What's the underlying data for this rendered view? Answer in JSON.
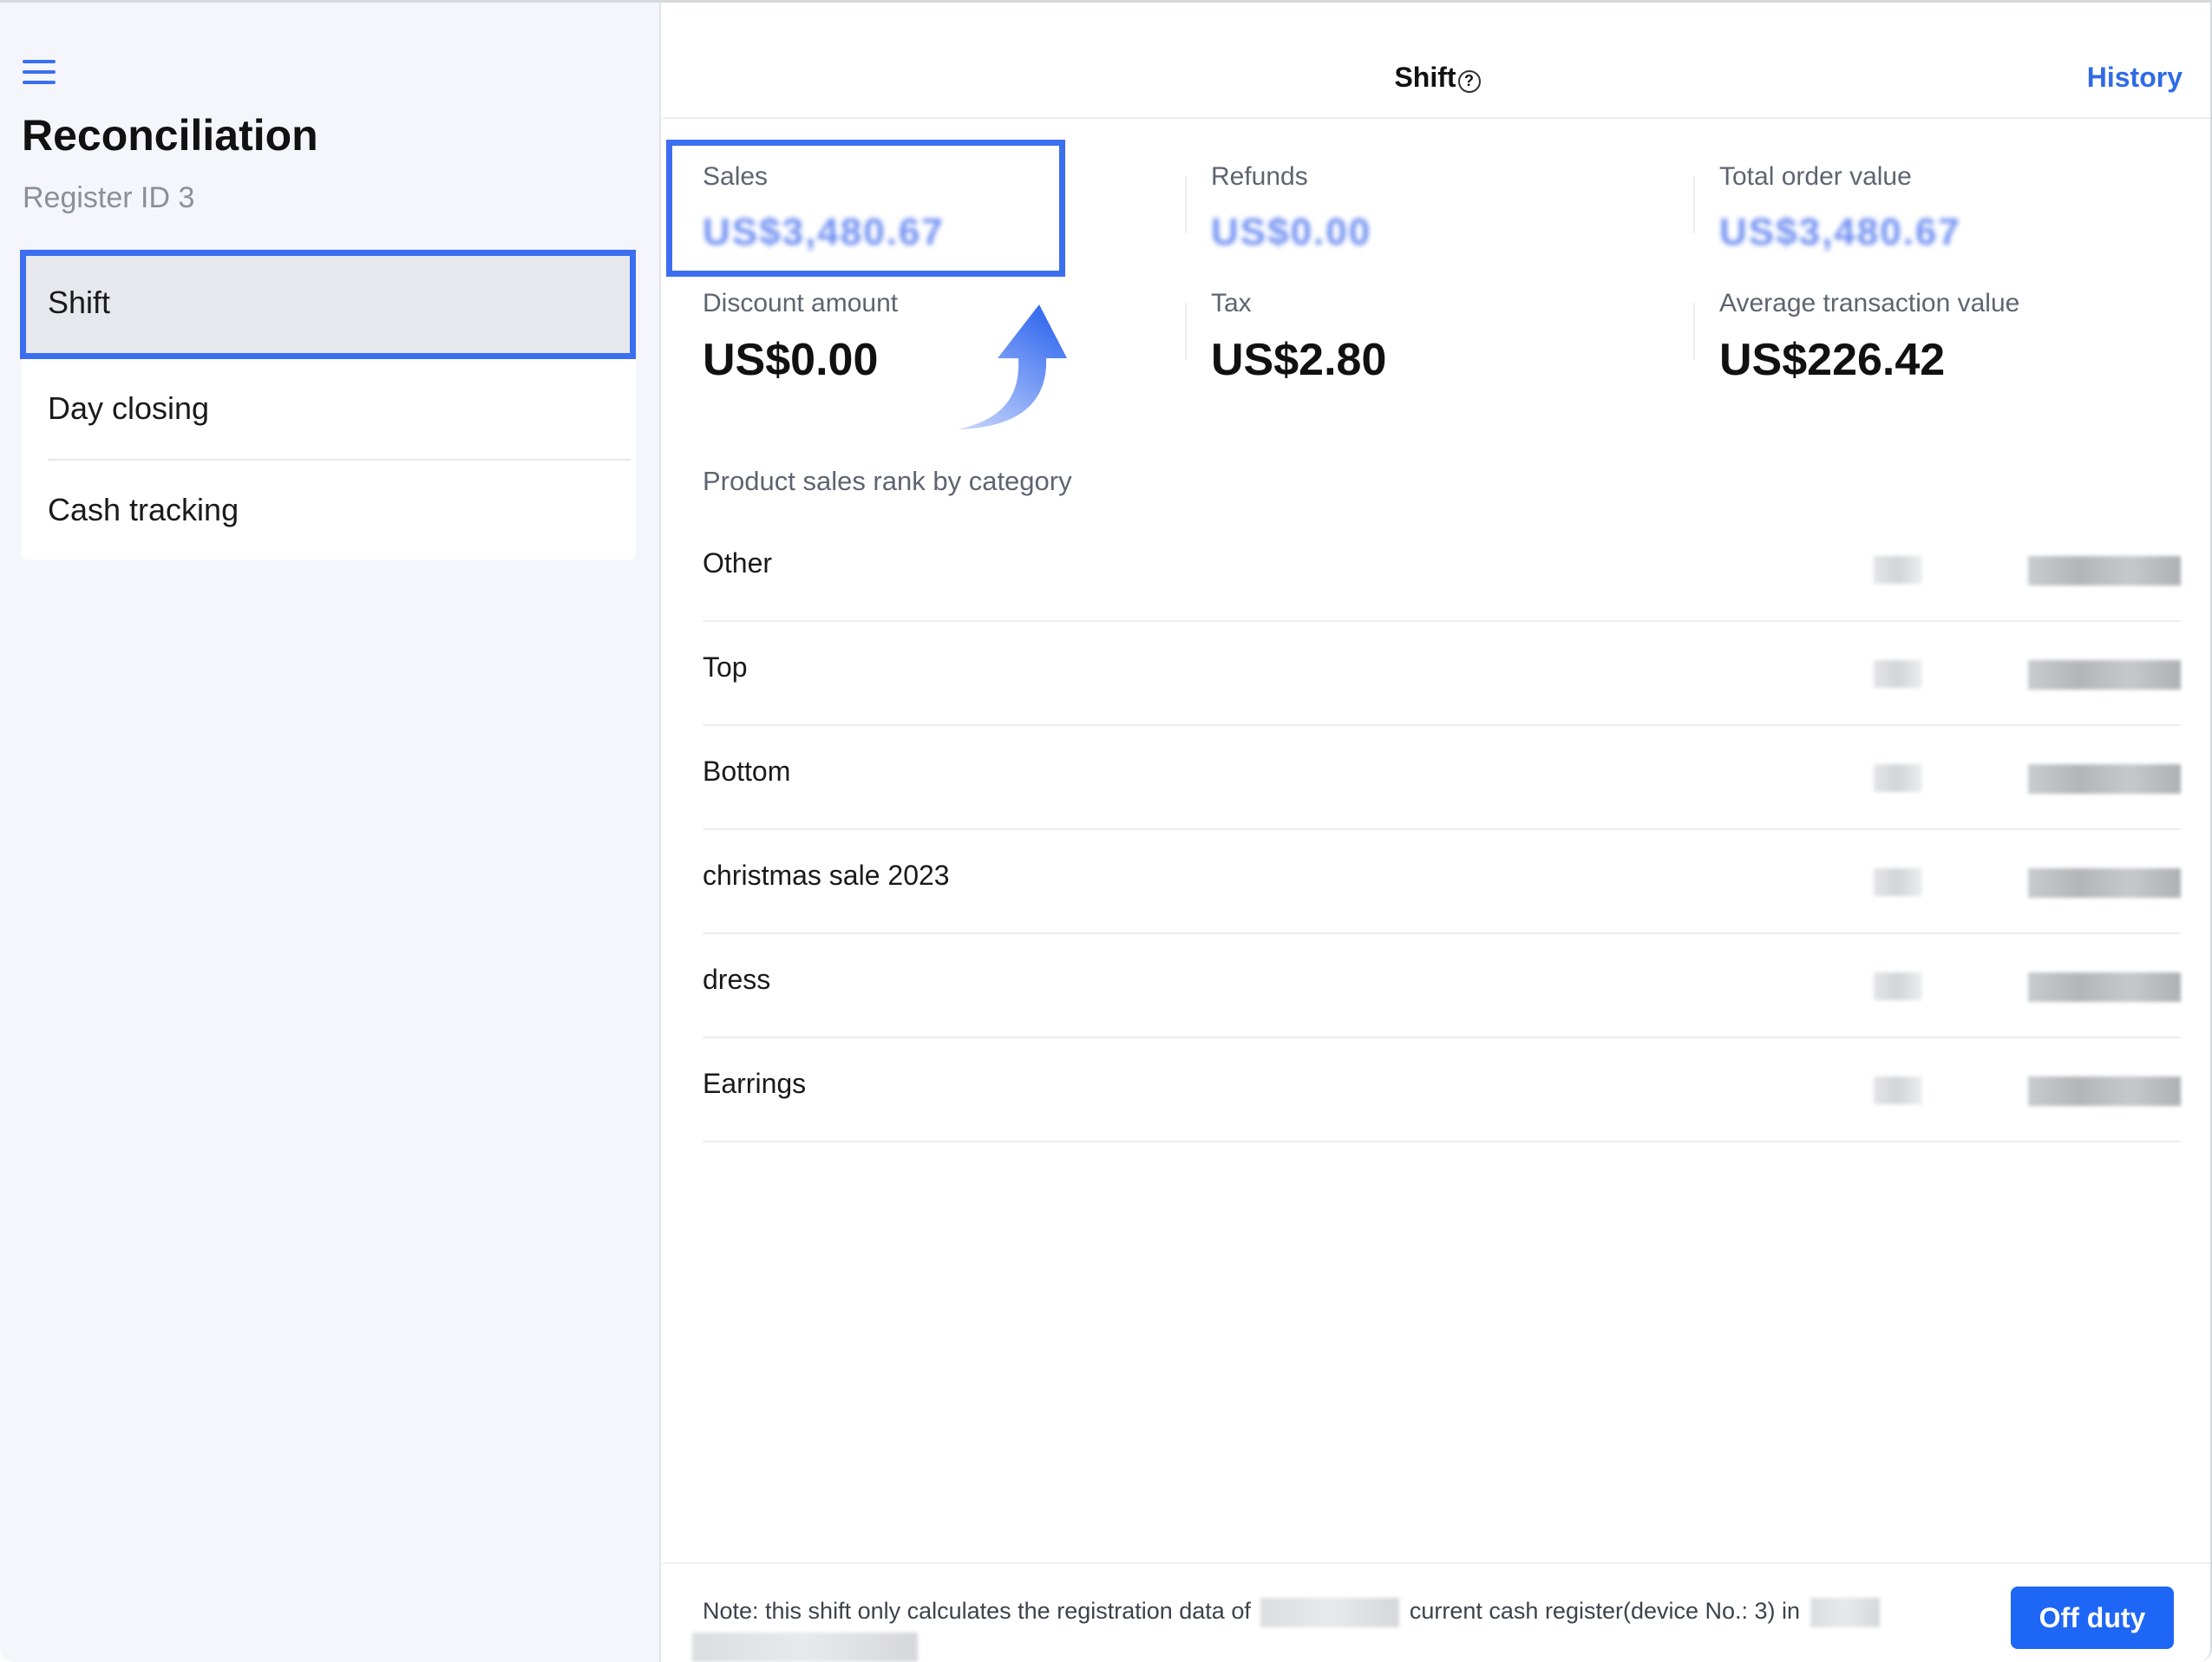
{
  "sidebar": {
    "title": "Reconciliation",
    "subtitle": "Register ID 3",
    "items": [
      {
        "label": "Shift",
        "active": true
      },
      {
        "label": "Day closing",
        "active": false
      },
      {
        "label": "Cash tracking",
        "active": false
      }
    ]
  },
  "header": {
    "title": "Shift",
    "help_glyph": "?",
    "history_label": "History"
  },
  "stats": {
    "sales": {
      "label": "Sales",
      "value": "US$3,480.67"
    },
    "refunds": {
      "label": "Refunds",
      "value": "US$0.00"
    },
    "total_order_value": {
      "label": "Total order value",
      "value": "US$3,480.67"
    },
    "discount_amount": {
      "label": "Discount amount",
      "value": "US$0.00"
    },
    "tax": {
      "label": "Tax",
      "value": "US$2.80"
    },
    "average_transaction_value": {
      "label": "Average transaction value",
      "value": "US$226.42"
    }
  },
  "ranking": {
    "label": "Product sales rank by category",
    "rows": [
      {
        "name": "Other"
      },
      {
        "name": "Top"
      },
      {
        "name": "Bottom"
      },
      {
        "name": "christmas sale 2023"
      },
      {
        "name": "dress"
      },
      {
        "name": "Earrings"
      }
    ]
  },
  "footer": {
    "note_part1": "Note: this shift only calculates the registration data of",
    "note_part2": "current cash register(device No.: 3) in",
    "off_duty_label": "Off duty"
  },
  "colors": {
    "accent": "#3b6ff0",
    "button": "#1e66f5",
    "link": "#2f6be5",
    "sidebar_bg": "#f4f6fb"
  }
}
